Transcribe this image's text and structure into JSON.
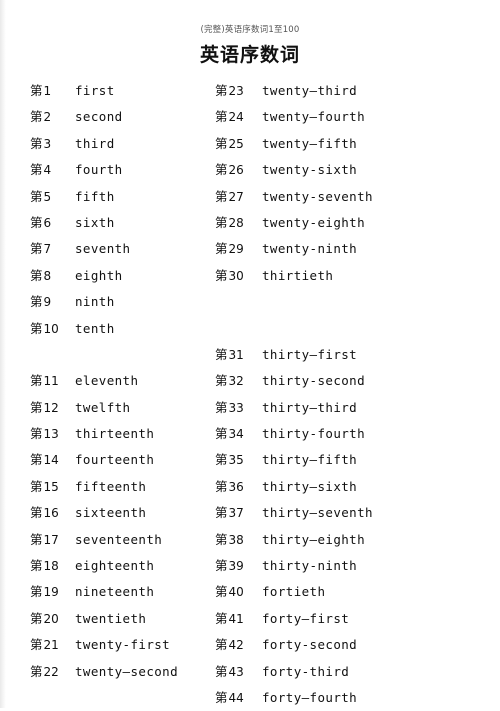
{
  "document": {
    "header_note": "(完整)英语序数词1至100",
    "title": "英语序数词"
  },
  "table": {
    "prefix": "第",
    "left_column": [
      {
        "number": "1",
        "word": "first"
      },
      {
        "number": "2",
        "word": "second"
      },
      {
        "number": "3",
        "word": "third"
      },
      {
        "number": "4",
        "word": "fourth"
      },
      {
        "number": "5",
        "word": "fifth"
      },
      {
        "number": "6",
        "word": "sixth"
      },
      {
        "number": "7",
        "word": "seventh"
      },
      {
        "number": "8",
        "word": "eighth"
      },
      {
        "number": "9",
        "word": "ninth"
      },
      {
        "number": "10",
        "word": "tenth"
      },
      {
        "number": "",
        "word": "",
        "blank": true
      },
      {
        "number": "11",
        "word": "eleventh"
      },
      {
        "number": "12",
        "word": "twelfth"
      },
      {
        "number": "13",
        "word": "thirteenth"
      },
      {
        "number": "14",
        "word": "fourteenth"
      },
      {
        "number": "15",
        "word": "fifteenth"
      },
      {
        "number": "16",
        "word": "sixteenth"
      },
      {
        "number": "17",
        "word": "seventeenth"
      },
      {
        "number": "18",
        "word": "eighteenth"
      },
      {
        "number": "19",
        "word": "nineteenth"
      },
      {
        "number": "20",
        "word": "twentieth"
      },
      {
        "number": "21",
        "word": "twenty-first"
      },
      {
        "number": "22",
        "word": "twenty—second"
      }
    ],
    "right_column": [
      {
        "number": "23",
        "word": "twenty—third"
      },
      {
        "number": "24",
        "word": "twenty—fourth"
      },
      {
        "number": "25",
        "word": "twenty—fifth"
      },
      {
        "number": "26",
        "word": "twenty-sixth"
      },
      {
        "number": "27",
        "word": "twenty-seventh"
      },
      {
        "number": "28",
        "word": "twenty-eighth"
      },
      {
        "number": "29",
        "word": "twenty-ninth"
      },
      {
        "number": "30",
        "word": "thirtieth"
      },
      {
        "number": "",
        "word": "",
        "blank": true
      },
      {
        "number": "",
        "word": "",
        "blank": true
      },
      {
        "number": "31",
        "word": "thirty—first"
      },
      {
        "number": "32",
        "word": "thirty-second"
      },
      {
        "number": "33",
        "word": "thirty—third"
      },
      {
        "number": "34",
        "word": "thirty-fourth"
      },
      {
        "number": "35",
        "word": "thirty—fifth"
      },
      {
        "number": "36",
        "word": "thirty—sixth"
      },
      {
        "number": "37",
        "word": "thirty—seventh"
      },
      {
        "number": "38",
        "word": "thirty—eighth"
      },
      {
        "number": "39",
        "word": "thirty-ninth"
      },
      {
        "number": "40",
        "word": "fortieth"
      },
      {
        "number": "41",
        "word": "forty—first"
      },
      {
        "number": "42",
        "word": "forty-second"
      },
      {
        "number": "43",
        "word": "forty-third"
      },
      {
        "number": "44",
        "word": "forty—fourth"
      }
    ]
  },
  "colors": {
    "text": "#111111",
    "header_note": "#555555",
    "background": "#ffffff"
  }
}
